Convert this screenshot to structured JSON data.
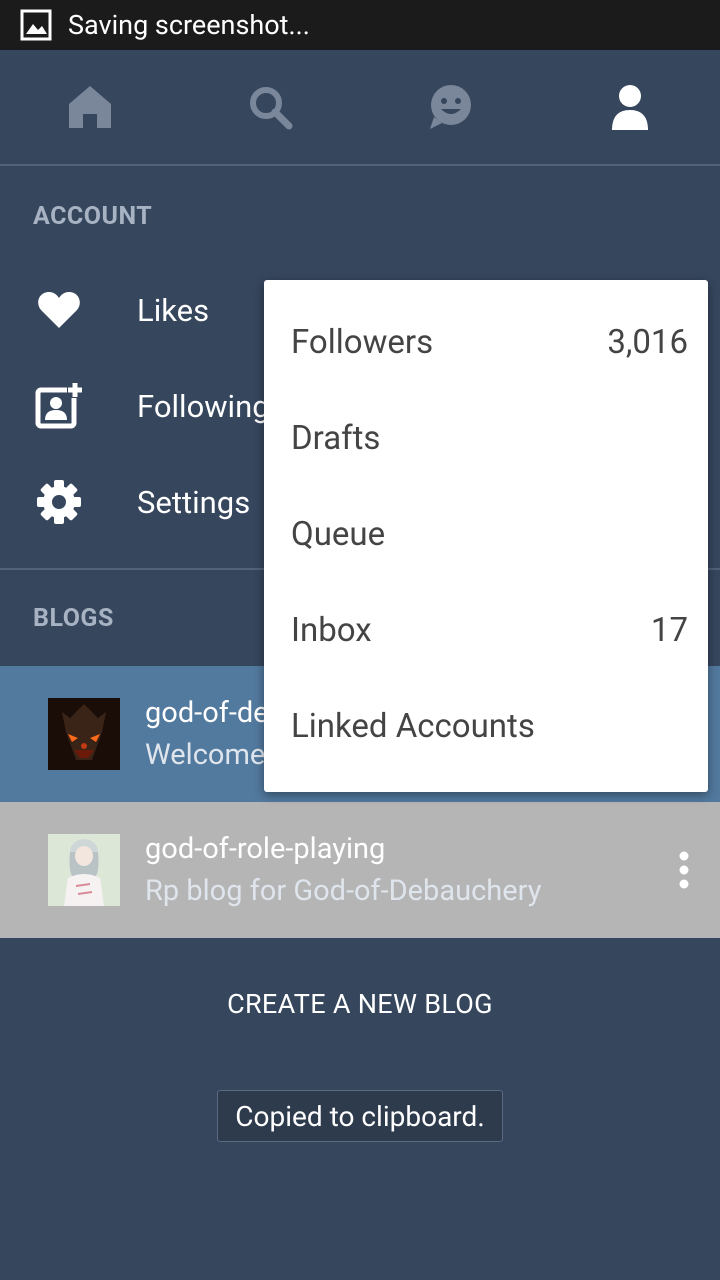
{
  "status_bar": {
    "text": "Saving screenshot..."
  },
  "tabs": [
    {
      "icon": "home-icon"
    },
    {
      "icon": "search-icon"
    },
    {
      "icon": "smiley-icon"
    },
    {
      "icon": "account-icon",
      "active": true
    }
  ],
  "account": {
    "header": "ACCOUNT",
    "items": [
      {
        "label": "Likes",
        "icon": "heart-icon"
      },
      {
        "label": "Following",
        "icon": "following-icon"
      },
      {
        "label": "Settings",
        "icon": "gear-icon"
      }
    ]
  },
  "blogs": {
    "header": "BLOGS",
    "items": [
      {
        "name": "god-of-de",
        "description": "Welcome"
      },
      {
        "name": "god-of-role-playing",
        "description": "Rp blog for God-of-Debauchery"
      }
    ],
    "create_label": "CREATE A NEW BLOG"
  },
  "popup_menu": {
    "items": [
      {
        "label": "Followers",
        "count": "3,016"
      },
      {
        "label": "Drafts",
        "count": ""
      },
      {
        "label": "Queue",
        "count": ""
      },
      {
        "label": "Inbox",
        "count": "17"
      },
      {
        "label": "Linked Accounts",
        "count": ""
      }
    ]
  },
  "toast": {
    "text": "Copied to clipboard."
  },
  "colors": {
    "background": "#36465d",
    "selected_row": "#52799e",
    "gray_row": "#b5b5b5",
    "status_bar": "#1b1b1b"
  }
}
